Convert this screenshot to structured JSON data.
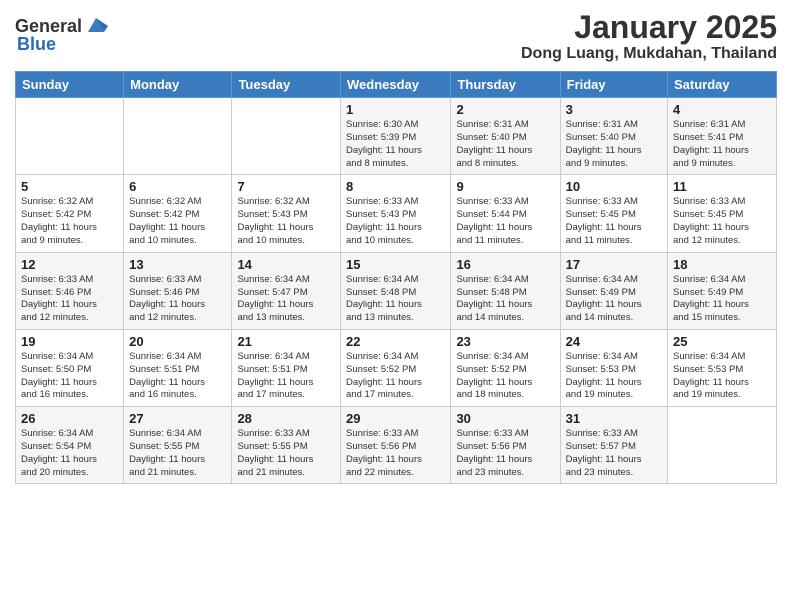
{
  "header": {
    "logo_general": "General",
    "logo_blue": "Blue",
    "month": "January 2025",
    "location": "Dong Luang, Mukdahan, Thailand"
  },
  "weekdays": [
    "Sunday",
    "Monday",
    "Tuesday",
    "Wednesday",
    "Thursday",
    "Friday",
    "Saturday"
  ],
  "weeks": [
    [
      {
        "day": "",
        "info": ""
      },
      {
        "day": "",
        "info": ""
      },
      {
        "day": "",
        "info": ""
      },
      {
        "day": "1",
        "info": "Sunrise: 6:30 AM\nSunset: 5:39 PM\nDaylight: 11 hours\nand 8 minutes."
      },
      {
        "day": "2",
        "info": "Sunrise: 6:31 AM\nSunset: 5:40 PM\nDaylight: 11 hours\nand 8 minutes."
      },
      {
        "day": "3",
        "info": "Sunrise: 6:31 AM\nSunset: 5:40 PM\nDaylight: 11 hours\nand 9 minutes."
      },
      {
        "day": "4",
        "info": "Sunrise: 6:31 AM\nSunset: 5:41 PM\nDaylight: 11 hours\nand 9 minutes."
      }
    ],
    [
      {
        "day": "5",
        "info": "Sunrise: 6:32 AM\nSunset: 5:42 PM\nDaylight: 11 hours\nand 9 minutes."
      },
      {
        "day": "6",
        "info": "Sunrise: 6:32 AM\nSunset: 5:42 PM\nDaylight: 11 hours\nand 10 minutes."
      },
      {
        "day": "7",
        "info": "Sunrise: 6:32 AM\nSunset: 5:43 PM\nDaylight: 11 hours\nand 10 minutes."
      },
      {
        "day": "8",
        "info": "Sunrise: 6:33 AM\nSunset: 5:43 PM\nDaylight: 11 hours\nand 10 minutes."
      },
      {
        "day": "9",
        "info": "Sunrise: 6:33 AM\nSunset: 5:44 PM\nDaylight: 11 hours\nand 11 minutes."
      },
      {
        "day": "10",
        "info": "Sunrise: 6:33 AM\nSunset: 5:45 PM\nDaylight: 11 hours\nand 11 minutes."
      },
      {
        "day": "11",
        "info": "Sunrise: 6:33 AM\nSunset: 5:45 PM\nDaylight: 11 hours\nand 12 minutes."
      }
    ],
    [
      {
        "day": "12",
        "info": "Sunrise: 6:33 AM\nSunset: 5:46 PM\nDaylight: 11 hours\nand 12 minutes."
      },
      {
        "day": "13",
        "info": "Sunrise: 6:33 AM\nSunset: 5:46 PM\nDaylight: 11 hours\nand 12 minutes."
      },
      {
        "day": "14",
        "info": "Sunrise: 6:34 AM\nSunset: 5:47 PM\nDaylight: 11 hours\nand 13 minutes."
      },
      {
        "day": "15",
        "info": "Sunrise: 6:34 AM\nSunset: 5:48 PM\nDaylight: 11 hours\nand 13 minutes."
      },
      {
        "day": "16",
        "info": "Sunrise: 6:34 AM\nSunset: 5:48 PM\nDaylight: 11 hours\nand 14 minutes."
      },
      {
        "day": "17",
        "info": "Sunrise: 6:34 AM\nSunset: 5:49 PM\nDaylight: 11 hours\nand 14 minutes."
      },
      {
        "day": "18",
        "info": "Sunrise: 6:34 AM\nSunset: 5:49 PM\nDaylight: 11 hours\nand 15 minutes."
      }
    ],
    [
      {
        "day": "19",
        "info": "Sunrise: 6:34 AM\nSunset: 5:50 PM\nDaylight: 11 hours\nand 16 minutes."
      },
      {
        "day": "20",
        "info": "Sunrise: 6:34 AM\nSunset: 5:51 PM\nDaylight: 11 hours\nand 16 minutes."
      },
      {
        "day": "21",
        "info": "Sunrise: 6:34 AM\nSunset: 5:51 PM\nDaylight: 11 hours\nand 17 minutes."
      },
      {
        "day": "22",
        "info": "Sunrise: 6:34 AM\nSunset: 5:52 PM\nDaylight: 11 hours\nand 17 minutes."
      },
      {
        "day": "23",
        "info": "Sunrise: 6:34 AM\nSunset: 5:52 PM\nDaylight: 11 hours\nand 18 minutes."
      },
      {
        "day": "24",
        "info": "Sunrise: 6:34 AM\nSunset: 5:53 PM\nDaylight: 11 hours\nand 19 minutes."
      },
      {
        "day": "25",
        "info": "Sunrise: 6:34 AM\nSunset: 5:53 PM\nDaylight: 11 hours\nand 19 minutes."
      }
    ],
    [
      {
        "day": "26",
        "info": "Sunrise: 6:34 AM\nSunset: 5:54 PM\nDaylight: 11 hours\nand 20 minutes."
      },
      {
        "day": "27",
        "info": "Sunrise: 6:34 AM\nSunset: 5:55 PM\nDaylight: 11 hours\nand 21 minutes."
      },
      {
        "day": "28",
        "info": "Sunrise: 6:33 AM\nSunset: 5:55 PM\nDaylight: 11 hours\nand 21 minutes."
      },
      {
        "day": "29",
        "info": "Sunrise: 6:33 AM\nSunset: 5:56 PM\nDaylight: 11 hours\nand 22 minutes."
      },
      {
        "day": "30",
        "info": "Sunrise: 6:33 AM\nSunset: 5:56 PM\nDaylight: 11 hours\nand 23 minutes."
      },
      {
        "day": "31",
        "info": "Sunrise: 6:33 AM\nSunset: 5:57 PM\nDaylight: 11 hours\nand 23 minutes."
      },
      {
        "day": "",
        "info": ""
      }
    ]
  ]
}
